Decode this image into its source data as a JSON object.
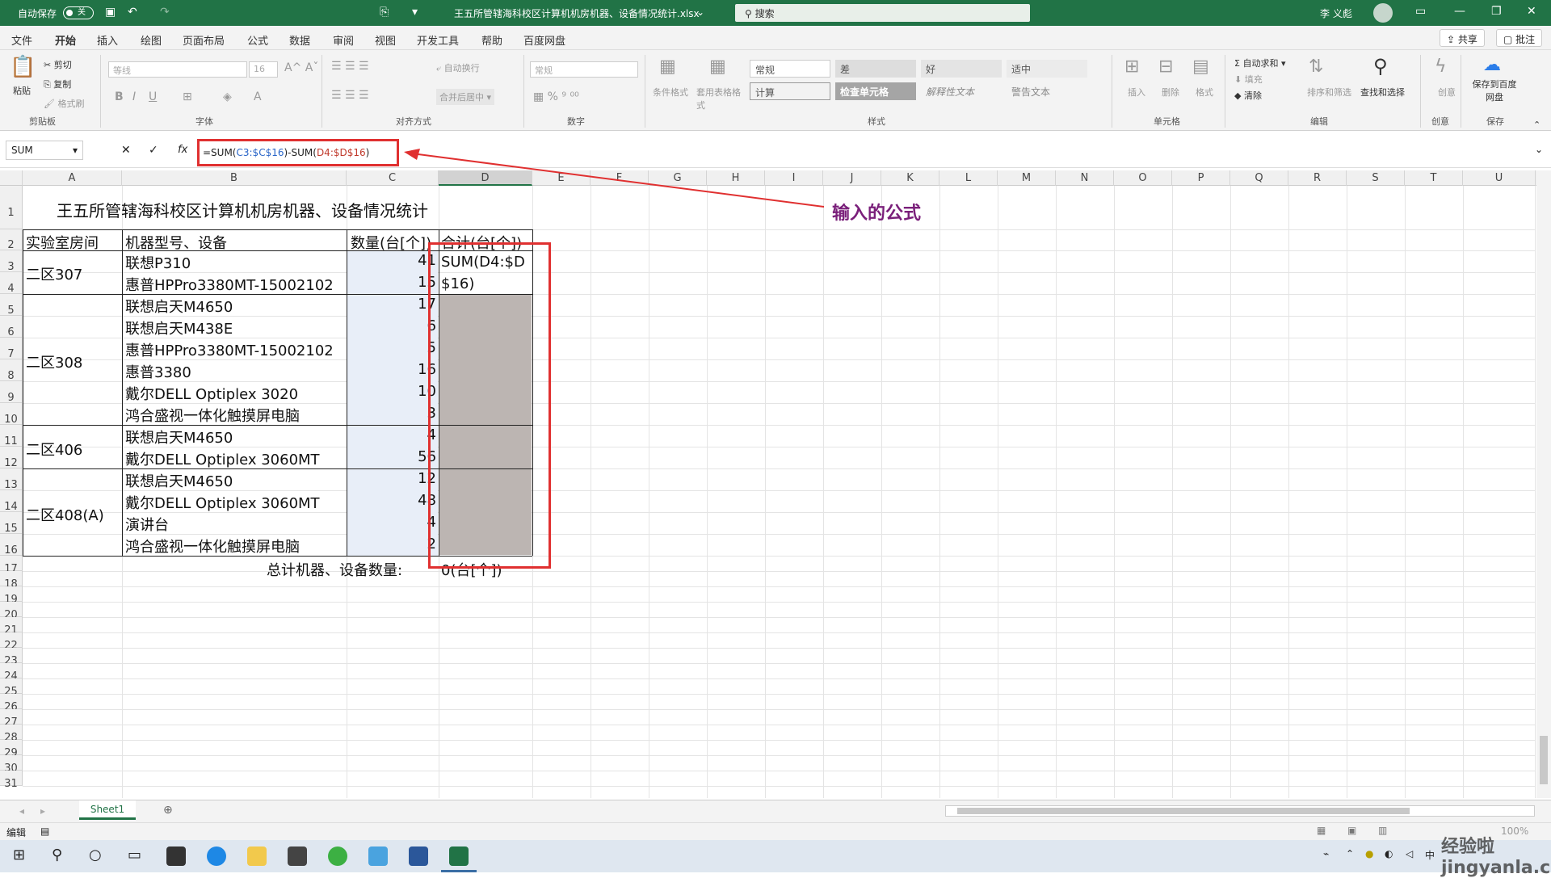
{
  "titlebar": {
    "autosave": "自动保存",
    "toggle": "关",
    "filename": "王五所管辖海科校区计算机机房机器、设备情况统计.xlsx",
    "search": "搜索",
    "user": "李 义彪"
  },
  "menu": {
    "tabs": [
      "文件",
      "开始",
      "插入",
      "绘图",
      "页面布局",
      "公式",
      "数据",
      "审阅",
      "视图",
      "开发工具",
      "帮助",
      "百度网盘"
    ],
    "share": "共享",
    "comment": "批注"
  },
  "ribbon": {
    "clipboard": {
      "paste": "粘贴",
      "cut": "剪切",
      "copy": "复制",
      "format_painter": "格式刷",
      "label": "剪贴板"
    },
    "font": {
      "name": "等线",
      "size": "16",
      "label": "字体"
    },
    "alignment": {
      "wrap": "自动换行",
      "merge": "合并后居中",
      "label": "对齐方式"
    },
    "number": {
      "format": "常规",
      "label": "数字"
    },
    "styles": {
      "cond": "条件格式",
      "table": "套用表格格式",
      "s1": "常规",
      "s2": "差",
      "s3": "好",
      "s4": "适中",
      "s5": "计算",
      "s6": "检查单元格",
      "s7": "解释性文本",
      "s8": "警告文本",
      "label": "样式"
    },
    "cells": {
      "insert": "插入",
      "delete": "删除",
      "format": "格式",
      "label": "单元格"
    },
    "editing": {
      "autosum": "自动求和",
      "fill": "填充",
      "clear": "清除",
      "sort": "排序和筛选",
      "find": "查找和选择",
      "label": "编辑"
    },
    "ideas": {
      "label": "创意",
      "sub": "创意"
    },
    "save": {
      "btn": "保存到百度网盘",
      "label": "保存"
    }
  },
  "formula": {
    "namebox": "SUM",
    "prefix": "=SUM(",
    "ref1": "C3:$C$16",
    "mid": ")-SUM(",
    "ref2": "D4:$D$16",
    "suffix": ")",
    "annotation": "输入的公式"
  },
  "columns": [
    "A",
    "B",
    "C",
    "D",
    "E",
    "F",
    "G",
    "H",
    "I",
    "J",
    "K",
    "L",
    "M",
    "N",
    "O",
    "P",
    "Q",
    "R",
    "S",
    "T",
    "U"
  ],
  "rows": [
    "1",
    "2",
    "3",
    "4",
    "5",
    "6",
    "7",
    "8",
    "9",
    "10",
    "11",
    "12",
    "13",
    "14",
    "15",
    "16",
    "17",
    "18",
    "19",
    "20",
    "21",
    "22",
    "23",
    "24",
    "25",
    "26",
    "27",
    "28",
    "29",
    "30",
    "31"
  ],
  "sheet": {
    "title": "王五所管辖海科校区计算机机房机器、设备情况统计",
    "headers": [
      "实验室房间",
      "机器型号、设备",
      "数量(台[个])",
      "合计(台[个])"
    ],
    "rooms": [
      "二区307",
      "二区308",
      "二区406",
      "二区408(A)"
    ],
    "devices": [
      "联想P310",
      "惠普HPPro3380MT-15002102",
      "联想启天M4650",
      "联想启天M438E",
      "惠普HPPro3380MT-15002102",
      "惠普3380",
      "戴尔DELL Optiplex 3020",
      "鸿合盛视一体化触摸屏电脑",
      "联想启天M4650",
      "戴尔DELL Optiplex 3060MT",
      "联想启天M4650",
      "戴尔DELL Optiplex 3060MT",
      "演讲台",
      "鸿合盛视一体化触摸屏电脑"
    ],
    "quantities": [
      "41",
      "15",
      "17",
      "6",
      "5",
      "16",
      "10",
      "3",
      "4",
      "56",
      "12",
      "48",
      "4",
      "2"
    ],
    "d3": "SUM(D4:$D",
    "d4": "$16)",
    "total_label": "总计机器、设备数量:",
    "total_value": "0(台[个])"
  },
  "sheetbar": {
    "tab": "Sheet1"
  },
  "status": {
    "mode": "编辑",
    "zoom": "100%"
  },
  "watermark": "经验啦 jingyanla.com"
}
